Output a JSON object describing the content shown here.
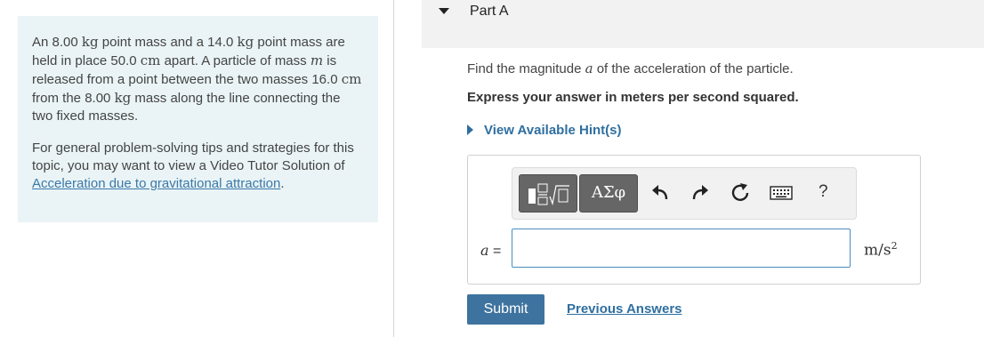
{
  "problem": {
    "p1_a": "An ",
    "p1_m1_num": "8.00",
    "p1_m1_unit": "kg",
    "p1_b": " point mass and a ",
    "p1_m2_num": "14.0",
    "p1_m2_unit": "kg",
    "p1_c": " point mass are held in place ",
    "p1_dist_num": "50.0",
    "p1_dist_unit": "cm",
    "p1_d": " apart. A particle of mass ",
    "p1_mvar": "m",
    "p1_e": " is released from a point between the two masses ",
    "p1_d2_num": "16.0",
    "p1_d2_unit": "cm",
    "p1_f": " from the ",
    "p1_m3_num": "8.00",
    "p1_m3_unit": "kg",
    "p1_g": " mass along the line connecting the two fixed masses.",
    "p2_text": "For general problem-solving tips and strategies for this topic, you may want to view a Video Tutor Solution of",
    "p2_link": "Acceleration due to gravitational attraction",
    "p2_end": "."
  },
  "part": {
    "title": "Part A"
  },
  "question": {
    "prefix": "Find the magnitude ",
    "var": "a",
    "suffix": " of the acceleration of the particle.",
    "instruction": "Express your answer in meters per second squared.",
    "hints_label": "View Available Hint(s)"
  },
  "toolbar": {
    "symbols_label": "ΑΣφ",
    "help_label": "?",
    "icons": [
      "templates-icon",
      "greek-symbols-icon",
      "undo-icon",
      "redo-icon",
      "reset-icon",
      "keyboard-icon",
      "help-icon"
    ]
  },
  "answer": {
    "var_label": "a",
    "equals": " =",
    "value": "",
    "unit_base": "m/s",
    "unit_exp": "2"
  },
  "actions": {
    "submit_label": "Submit",
    "previous_label": "Previous Answers"
  },
  "colors": {
    "panel_bg": "#eaf4f6",
    "header_bg": "#f2f2f2",
    "link": "#2f6fa0",
    "submit_bg": "#3e739f",
    "toolbar_btn": "#666666",
    "input_border": "#4a8dbd"
  }
}
